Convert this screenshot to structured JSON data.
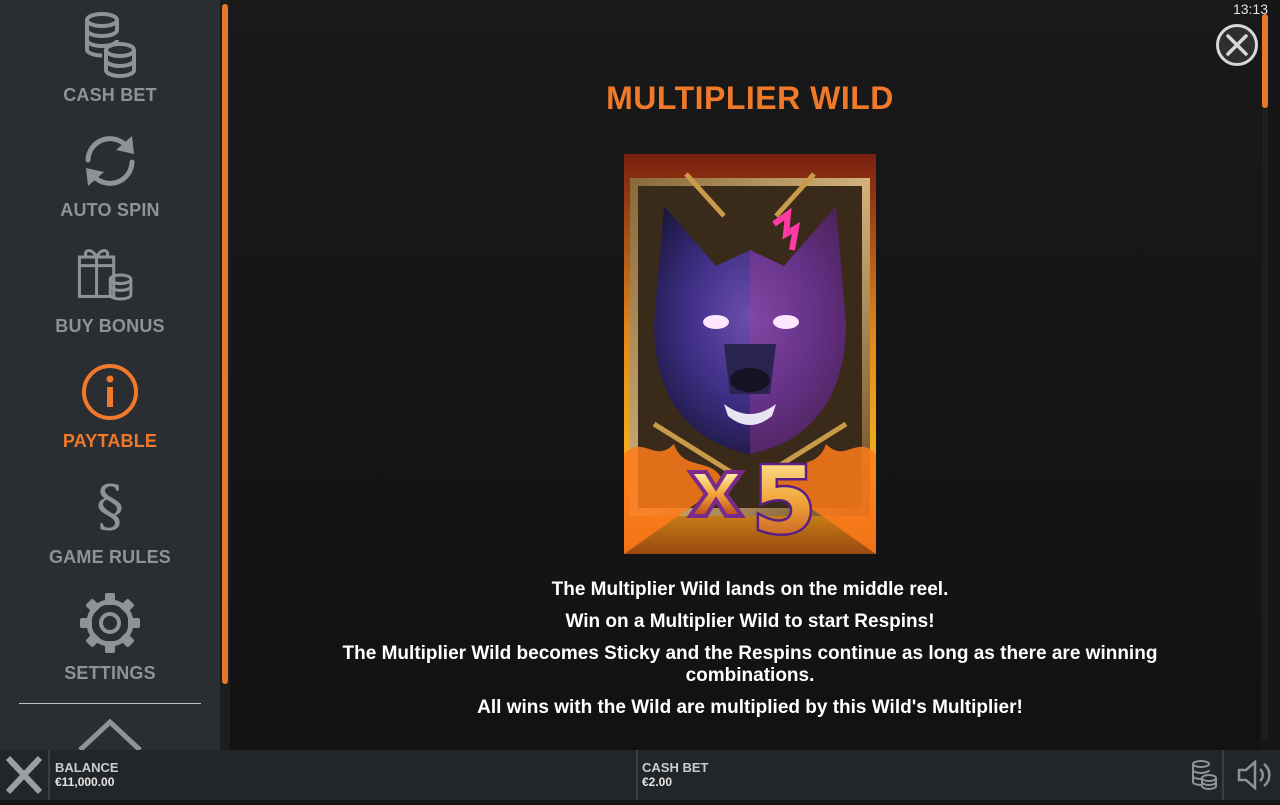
{
  "sidebar": {
    "items": [
      {
        "label": "CASH BET",
        "icon": "coins-stack-icon"
      },
      {
        "label": "AUTO SPIN",
        "icon": "refresh-icon"
      },
      {
        "label": "BUY BONUS",
        "icon": "gift-coins-icon"
      },
      {
        "label": "PAYTABLE",
        "icon": "info-icon",
        "active": true
      },
      {
        "label": "GAME RULES",
        "icon": "section-sign-icon"
      },
      {
        "label": "SETTINGS",
        "icon": "gear-icon"
      }
    ]
  },
  "clock": "13:13",
  "paytable": {
    "title": "MULTIPLIER WILD",
    "symbol": {
      "multiplier_text": "5",
      "name": "wolf-wild-symbol"
    },
    "lines": [
      "The Multiplier Wild lands on the middle reel.",
      "Win on a Multiplier Wild to start Respins!",
      "The Multiplier Wild becomes Sticky and the Respins continue as long as there are winning combinations.",
      "All wins with the Wild are multiplied by this Wild's Multiplier!"
    ]
  },
  "bottom_bar": {
    "balance_label": "BALANCE",
    "balance_value": "€11,000.00",
    "bet_label": "CASH BET",
    "bet_value": "€2.00"
  },
  "colors": {
    "accent": "#f07a2a",
    "sidebar_bg": "#2a2e32",
    "inactive_text": "#8f9296"
  }
}
